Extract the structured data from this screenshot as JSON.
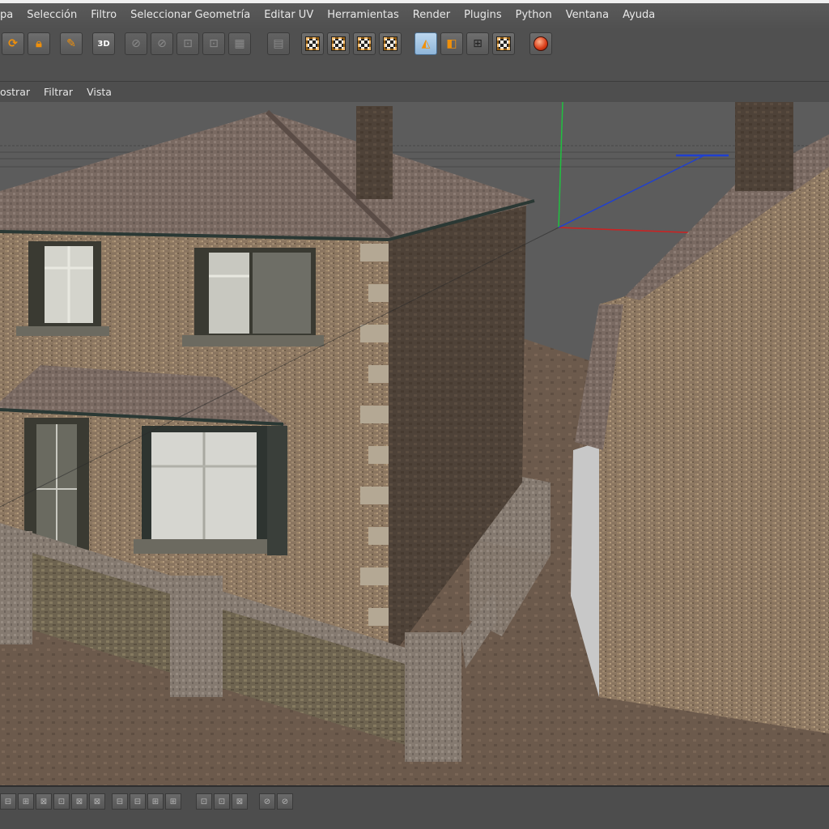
{
  "menu": {
    "items": [
      "pa",
      "Selección",
      "Filtro",
      "Seleccionar Geometría",
      "Editar UV",
      "Herramientas",
      "Render",
      "Plugins",
      "Python",
      "Ventana",
      "Ayuda"
    ]
  },
  "toolbar": {
    "tool_3d_label": "3D"
  },
  "viewport_menu": {
    "items": [
      "ostrar",
      "Filtrar",
      "Vista"
    ]
  },
  "colors": {
    "axis_x": "#d02020",
    "axis_y": "#20c040",
    "axis_z": "#2040d0",
    "accent_orange": "#f0900a",
    "active_blue": "#8fb6da"
  },
  "icons": {
    "toolbar": [
      "rotate-icon",
      "lock-texture-icon",
      "brush-icon",
      "brush-3d-icon",
      "mirror-x-icon",
      "mirror-y-icon",
      "subdiv-icon",
      "subdiv-2-icon",
      "grid-icon",
      "render-view-icon",
      "texture-mode-icon",
      "checker-icon",
      "axis-checker-icon",
      "checker-2-icon",
      "polygon-mode-icon",
      "quad-icon",
      "grid-view-icon",
      "grid-checker-icon",
      "render-globe-icon"
    ]
  }
}
